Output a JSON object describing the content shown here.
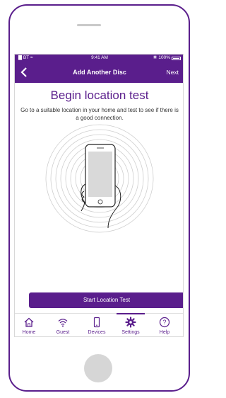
{
  "status_bar": {
    "carrier": "BT",
    "time": "9:41 AM",
    "battery": "100%"
  },
  "nav": {
    "title": "Add Another Disc",
    "next_label": "Next",
    "back_icon": "chevron-left-icon"
  },
  "content": {
    "title": "Begin location test",
    "description": "Go to a suitable location in your home and test to see if there is a good connection."
  },
  "start_button": {
    "label": "Start Location Test"
  },
  "tabs": [
    {
      "label": "Home",
      "icon": "home-icon"
    },
    {
      "label": "Guest",
      "icon": "wifi-icon"
    },
    {
      "label": "Devices",
      "icon": "phone-icon"
    },
    {
      "label": "Settings",
      "icon": "gear-icon",
      "active": true
    },
    {
      "label": "Help",
      "icon": "help-icon"
    }
  ],
  "colors": {
    "brand": "#5a1e8c",
    "home_button": "#d6d6d6"
  }
}
